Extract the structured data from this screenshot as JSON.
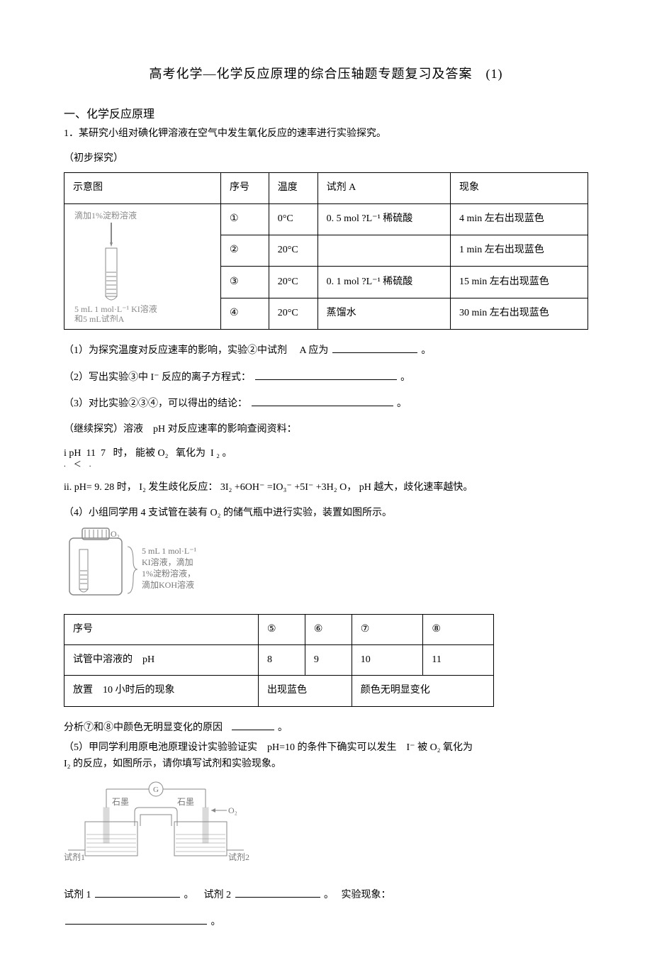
{
  "title": "高考化学—化学反应原理的综合压轴题专题复习及答案　(1)",
  "section_heading": "一、化学反应原理",
  "item1_q": "1．某研究小组对碘化钾溶液在空气中发生氧化反应的速率进行实验探究。",
  "item1_sub": "（初步探究）",
  "table1": {
    "headers": [
      "示意图",
      "序号",
      "温度",
      "试剂 A",
      "现象"
    ],
    "diagram": {
      "line1": "滴加1%淀粉溶液",
      "line2": "5 mL 1 mol·L⁻¹ KI溶液",
      "line3": "和5 mL试剂A"
    },
    "rows": [
      {
        "idx": "①",
        "temp": "0°C",
        "reagent": "0. 5 mol ?L⁻¹ 稀硫酸",
        "obs": "4 min 左右出现蓝色"
      },
      {
        "idx": "②",
        "temp": "20°C",
        "reagent": "",
        "obs": "1 min 左右出现蓝色"
      },
      {
        "idx": "③",
        "temp": "20°C",
        "reagent": "0. 1 mol ?L⁻¹ 稀硫酸",
        "obs": "15 min 左右出现蓝色"
      },
      {
        "idx": "④",
        "temp": "20°C",
        "reagent": "蒸馏水",
        "obs": "30 min 左右出现蓝色"
      }
    ]
  },
  "q1": {
    "pre": "（1）为探究温度对反应速率的影响，实验②中试剂",
    "A": "A 应为",
    "post": "。"
  },
  "q2": {
    "pre": "（2）写出实验③中 I⁻ 反应的离子方程式：",
    "post": "。"
  },
  "q3": {
    "pre": "（3）对比实验②③④，可以得出的结论：",
    "post": "。"
  },
  "continue": "（继续探究）溶液　pH 对反应速率的影响查阅资料：",
  "note_i_pre": "i pH",
  "note_i_mid1": "11",
  "note_i_lt": "＜",
  "note_i_mid2": "7",
  "note_i_shi": "时，",
  "note_i_neng": "能被 O₂",
  "note_i_yang": "氧化为",
  "note_i_I2": "I ₂",
  "note_i_dot": "。",
  "note_ii": "ii. pH= 9. 28 时， I₂ 发生歧化反应： 3I₂ +6OH⁻ =IO₃⁻ +5I⁻ +3H₂ O， pH 越大，歧化速率越快。",
  "q4": "（4）小组同学用 4 支试管在装有 O₂ 的储气瓶中进行实验，装置如图所示。",
  "fig2": {
    "o2": "O₂",
    "l1": "5 mL 1 mol·L⁻¹",
    "l2": "KI溶液，滴加",
    "l3": "1%淀粉溶液，",
    "l4": "滴加KOH溶液"
  },
  "table2": {
    "headers": [
      "序号",
      "⑤",
      "⑥",
      "⑦",
      "⑧"
    ],
    "row_ph_label": "试管中溶液的　pH",
    "row_ph": [
      "8",
      "9",
      "10",
      "11"
    ],
    "row_obs_label": "放置　10 小时后的现象",
    "row_obs_left": "出现蓝色",
    "row_obs_right": "颜色无明显变化"
  },
  "analysis": {
    "pre": "分析⑦和⑧中颜色无明显变化的原因",
    "post": "。"
  },
  "q5a": "（5）甲同学利用原电池原理设计实验验证实",
  "q5b": "pH=10 的条件下确实可以发生",
  "q5c": "I⁻ 被 O₂ 氧化为",
  "q5d": "I₂ 的反应，如图所示，请你填写试剂和实验现象。",
  "fig3": {
    "g": "G",
    "graphite": "石墨",
    "o2": "O₂",
    "r1": "试剂1",
    "r2": "试剂2"
  },
  "fill": {
    "r1": "试剂 1",
    "r2": "试剂 2",
    "obs": "实验现象：",
    "dot": "。"
  }
}
